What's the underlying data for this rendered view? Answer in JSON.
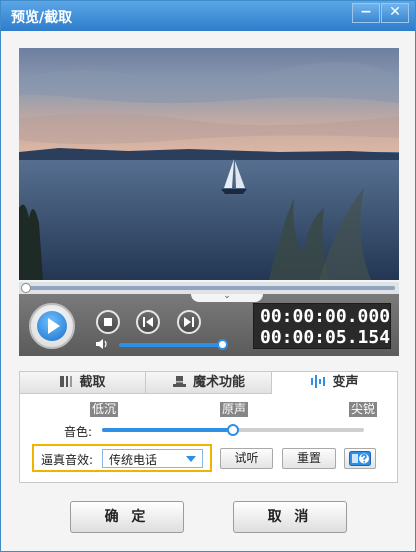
{
  "window": {
    "title": "预览/截取",
    "minimize_label": "−",
    "close_label": "✕"
  },
  "player": {
    "current_time": "00:00:00.000",
    "total_time": "00:00:05.154",
    "progress": 0,
    "volume": 0.96
  },
  "tabs": [
    {
      "label": "截取",
      "icon": "trim-icon",
      "active": false
    },
    {
      "label": "魔术功能",
      "icon": "magic-hat-icon",
      "active": false
    },
    {
      "label": "变声",
      "icon": "waveform-icon",
      "active": true
    }
  ],
  "voice": {
    "pitch_low": "低沉",
    "pitch_original": "原声",
    "pitch_high": "尖锐",
    "tone_label": "音色:",
    "tone_level": 0.5,
    "effect_label": "逼真音效:",
    "effect_value": "传统电话",
    "preview_button": "试听",
    "reset_button": "重置"
  },
  "footer": {
    "ok_label": "确 定",
    "cancel_label": "取 消"
  },
  "colors": {
    "title_bar": "#3a86d2",
    "accent": "#2e8fe6",
    "highlight_border": "#f0b400"
  }
}
